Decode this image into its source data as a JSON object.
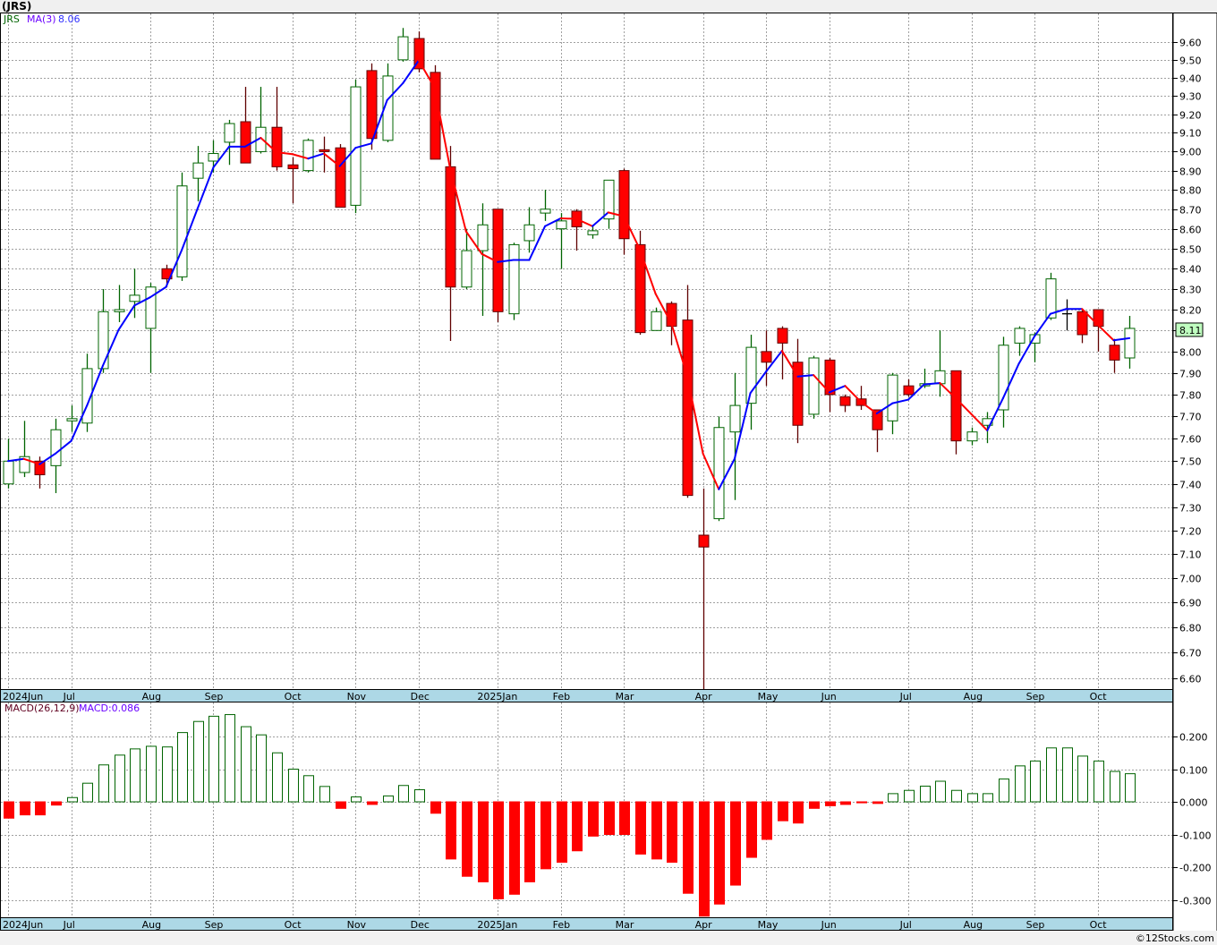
{
  "header": {
    "title": "(JRS)"
  },
  "legend": {
    "symbol": "JRS",
    "ma_label": "MA(3)",
    "ma_value": "8.06"
  },
  "macd_legend": {
    "label": "MACD(26,12,9)",
    "value": "MACD:0.086"
  },
  "last_price": "8.11",
  "footer": {
    "copyright": "©12Stocks.com"
  },
  "colors": {
    "up": "#006400",
    "down_fill": "#ff0000",
    "down_stroke": "#600000",
    "ma_up": "#0000ff",
    "ma_down": "#ff0000",
    "date_strip": "#add8e6",
    "last_price_bg": "#c0ffc0"
  },
  "chart_data": [
    {
      "type": "candlestick",
      "title": "(JRS)",
      "interval": "weekly",
      "yscale": "log",
      "ylim": [
        6.55,
        9.7
      ],
      "grid": true,
      "y_ticks": [
        "6.60",
        "6.70",
        "6.80",
        "6.90",
        "7.00",
        "7.10",
        "7.20",
        "7.30",
        "7.40",
        "7.50",
        "7.60",
        "7.70",
        "7.80",
        "7.90",
        "8.00",
        "8.10",
        "8.20",
        "8.30",
        "8.40",
        "8.50",
        "8.60",
        "8.70",
        "8.80",
        "8.90",
        "9.00",
        "9.10",
        "9.20",
        "9.30",
        "9.40",
        "9.50",
        "9.60"
      ],
      "x_ticks": [
        {
          "label": "2024Jun",
          "index": 0
        },
        {
          "label": "Jul",
          "index": 4
        },
        {
          "label": "Aug",
          "index": 9
        },
        {
          "label": "Sep",
          "index": 13
        },
        {
          "label": "Oct",
          "index": 18
        },
        {
          "label": "Nov",
          "index": 22
        },
        {
          "label": "Dec",
          "index": 26
        },
        {
          "label": "2025Jan",
          "index": 31
        },
        {
          "label": "Feb",
          "index": 35
        },
        {
          "label": "Mar",
          "index": 39
        },
        {
          "label": "Apr",
          "index": 44
        },
        {
          "label": "May",
          "index": 48
        },
        {
          "label": "Jun",
          "index": 52
        },
        {
          "label": "Jul",
          "index": 57
        },
        {
          "label": "Aug",
          "index": 61
        },
        {
          "label": "Sep",
          "index": 65
        },
        {
          "label": "Oct",
          "index": 69
        }
      ],
      "overlay": {
        "name": "MA(3)",
        "period": 3
      },
      "ohlc_fields": [
        "open",
        "high",
        "low",
        "close"
      ],
      "ohlc": [
        [
          7.4,
          7.6,
          7.38,
          7.5
        ],
        [
          7.45,
          7.68,
          7.43,
          7.52
        ],
        [
          7.5,
          7.52,
          7.38,
          7.44
        ],
        [
          7.48,
          7.69,
          7.36,
          7.64
        ],
        [
          7.68,
          7.75,
          7.63,
          7.69
        ],
        [
          7.67,
          7.99,
          7.63,
          7.92
        ],
        [
          7.92,
          8.3,
          7.9,
          8.19
        ],
        [
          8.19,
          8.32,
          8.14,
          8.2
        ],
        [
          8.24,
          8.4,
          8.16,
          8.27
        ],
        [
          8.11,
          8.33,
          7.9,
          8.31
        ],
        [
          8.4,
          8.42,
          8.31,
          8.35
        ],
        [
          8.36,
          8.89,
          8.34,
          8.82
        ],
        [
          8.86,
          9.03,
          8.74,
          8.94
        ],
        [
          8.95,
          9.06,
          8.89,
          8.99
        ],
        [
          9.05,
          9.17,
          8.93,
          9.15
        ],
        [
          9.16,
          9.35,
          8.94,
          8.94
        ],
        [
          9.0,
          9.35,
          8.99,
          9.13
        ],
        [
          9.13,
          9.35,
          8.9,
          8.92
        ],
        [
          8.93,
          8.97,
          8.73,
          8.91
        ],
        [
          8.9,
          9.07,
          8.89,
          9.06
        ],
        [
          9.01,
          9.08,
          8.89,
          9.0
        ],
        [
          9.02,
          9.04,
          8.71,
          8.71
        ],
        [
          8.72,
          9.39,
          8.68,
          9.35
        ],
        [
          9.44,
          9.48,
          9.01,
          9.07
        ],
        [
          9.06,
          9.48,
          9.05,
          9.41
        ],
        [
          9.5,
          9.68,
          9.49,
          9.63
        ],
        [
          9.62,
          9.66,
          9.43,
          9.45
        ],
        [
          9.43,
          9.47,
          8.96,
          8.96
        ],
        [
          8.92,
          9.03,
          8.05,
          8.31
        ],
        [
          8.31,
          8.6,
          8.3,
          8.49
        ],
        [
          8.49,
          8.73,
          8.17,
          8.62
        ],
        [
          8.7,
          8.7,
          8.14,
          8.19
        ],
        [
          8.18,
          8.53,
          8.15,
          8.52
        ],
        [
          8.54,
          8.71,
          8.48,
          8.62
        ],
        [
          8.68,
          8.8,
          8.64,
          8.7
        ],
        [
          8.6,
          8.68,
          8.4,
          8.64
        ],
        [
          8.69,
          8.7,
          8.49,
          8.61
        ],
        [
          8.57,
          8.62,
          8.55,
          8.59
        ],
        [
          8.65,
          8.85,
          8.6,
          8.85
        ],
        [
          8.9,
          8.91,
          8.47,
          8.55
        ],
        [
          8.52,
          8.59,
          8.08,
          8.09
        ],
        [
          8.1,
          8.21,
          8.1,
          8.19
        ],
        [
          8.23,
          8.24,
          8.03,
          8.12
        ],
        [
          8.15,
          8.32,
          7.34,
          7.35
        ],
        [
          7.18,
          7.38,
          6.55,
          7.13
        ],
        [
          7.25,
          7.7,
          7.24,
          7.65
        ],
        [
          7.63,
          7.9,
          7.33,
          7.75
        ],
        [
          7.76,
          8.08,
          7.64,
          8.02
        ],
        [
          8.0,
          8.1,
          7.84,
          7.95
        ],
        [
          8.11,
          8.12,
          7.87,
          8.04
        ],
        [
          7.95,
          8.06,
          7.58,
          7.66
        ],
        [
          7.71,
          7.98,
          7.69,
          7.97
        ],
        [
          7.96,
          7.97,
          7.72,
          7.8
        ],
        [
          7.79,
          7.8,
          7.72,
          7.75
        ],
        [
          7.78,
          7.84,
          7.73,
          7.75
        ],
        [
          7.73,
          7.73,
          7.54,
          7.64
        ],
        [
          7.68,
          7.9,
          7.62,
          7.89
        ],
        [
          7.84,
          7.87,
          7.79,
          7.8
        ],
        [
          7.84,
          7.92,
          7.83,
          7.85
        ],
        [
          7.85,
          8.1,
          7.79,
          7.91
        ],
        [
          7.91,
          7.91,
          7.53,
          7.59
        ],
        [
          7.59,
          7.65,
          7.57,
          7.63
        ],
        [
          7.66,
          7.72,
          7.58,
          7.69
        ],
        [
          7.73,
          8.07,
          7.65,
          8.03
        ],
        [
          8.04,
          8.12,
          7.98,
          8.11
        ],
        [
          8.04,
          8.09,
          7.95,
          8.08
        ],
        [
          8.16,
          8.38,
          8.15,
          8.35
        ],
        [
          8.18,
          8.25,
          8.1,
          8.18
        ],
        [
          8.19,
          8.2,
          8.04,
          8.08
        ],
        [
          8.2,
          8.2,
          8.0,
          8.12
        ],
        [
          8.03,
          8.06,
          7.9,
          7.96
        ],
        [
          7.97,
          8.17,
          7.92,
          8.11
        ]
      ]
    },
    {
      "type": "bar",
      "title": "MACD(26,12,9)",
      "ylim": [
        -0.36,
        0.3
      ],
      "grid": true,
      "y_ticks": [
        "0.200",
        "0.100",
        "0.000",
        "-0.100",
        "-0.200",
        "-0.300"
      ],
      "values": [
        -0.05,
        -0.04,
        -0.04,
        -0.01,
        0.013,
        0.057,
        0.113,
        0.143,
        0.162,
        0.17,
        0.168,
        0.212,
        0.246,
        0.262,
        0.267,
        0.23,
        0.205,
        0.15,
        0.1,
        0.08,
        0.047,
        -0.02,
        0.015,
        -0.008,
        0.018,
        0.05,
        0.037,
        -0.035,
        -0.175,
        -0.228,
        -0.245,
        -0.297,
        -0.283,
        -0.245,
        -0.205,
        -0.185,
        -0.15,
        -0.105,
        -0.1,
        -0.1,
        -0.16,
        -0.175,
        -0.185,
        -0.28,
        -0.35,
        -0.313,
        -0.255,
        -0.17,
        -0.115,
        -0.058,
        -0.065,
        -0.02,
        -0.012,
        -0.008,
        -0.003,
        -0.005,
        0.025,
        0.035,
        0.048,
        0.063,
        0.035,
        0.025,
        0.025,
        0.07,
        0.11,
        0.125,
        0.165,
        0.165,
        0.14,
        0.125,
        0.093,
        0.086
      ]
    }
  ]
}
